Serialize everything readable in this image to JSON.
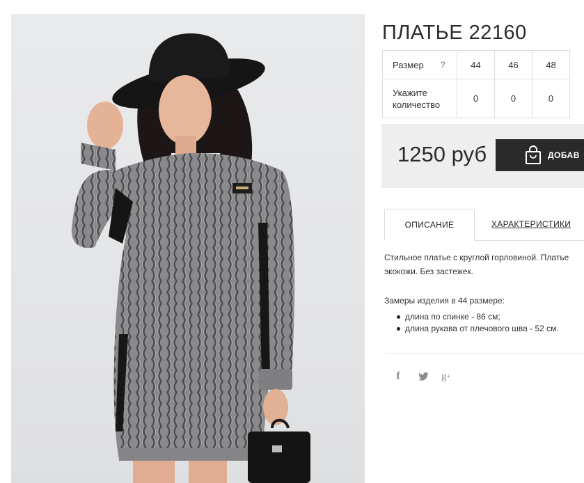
{
  "product": {
    "title": "ПЛАТЬЕ 22160"
  },
  "size_table": {
    "size_label": "Размер",
    "help_icon": "?",
    "sizes": [
      "44",
      "46",
      "48"
    ],
    "qty_label_line1": "Укажите",
    "qty_label_line2": "количество",
    "quantities": [
      "0",
      "0",
      "0"
    ]
  },
  "buy": {
    "price": "1250 руб",
    "add_button_label": "ДОБАВ",
    "button_icon": "shopping-bag-icon",
    "background_color": "#eeeeee",
    "button_color": "#2a2a2a"
  },
  "tabs": [
    {
      "label": "ОПИСАНИЕ",
      "active": true
    },
    {
      "label": "ХАРАКТЕРИСТИКИ",
      "active": false
    }
  ],
  "description": {
    "line1": "Стильное платье с круглой горловиной. Платье",
    "line2": "экокожи. Без застежек.",
    "measure_title": "Замеры изделия в 44 размере:",
    "bullets": [
      "длина по спинке - 86 см;",
      "длина рукава от плечового шва - 52 см."
    ]
  },
  "social": {
    "facebook": "f",
    "google_plus": "g",
    "google_plus_sup": "+",
    "icons": [
      "facebook-icon",
      "twitter-icon",
      "google-plus-icon"
    ]
  }
}
